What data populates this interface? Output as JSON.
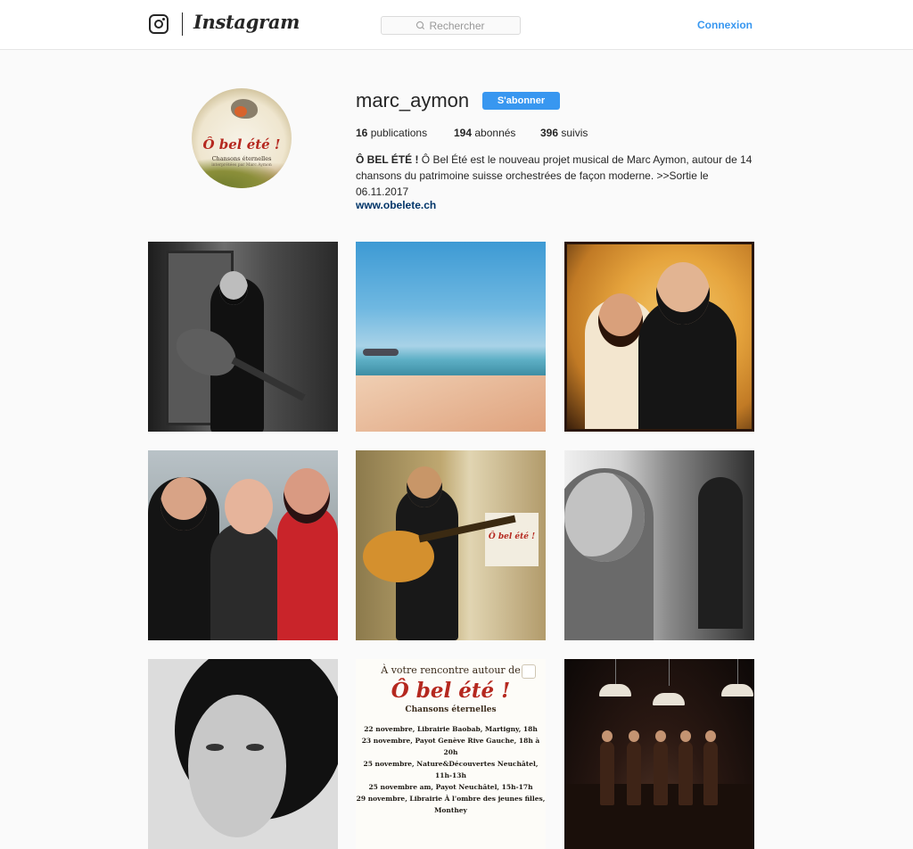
{
  "nav": {
    "wordmark": "Instagram",
    "search_placeholder": "Rechercher",
    "login_label": "Connexion",
    "icons": [
      "camera-icon",
      "search-icon"
    ]
  },
  "profile": {
    "username": "marc_aymon",
    "follow_label": "S'abonner",
    "stats": {
      "posts_count": "16",
      "posts_label": "publications",
      "followers_count": "194",
      "followers_label": "abonnés",
      "following_count": "396",
      "following_label": "suivis"
    },
    "bio_name": "Ô BEL ÉTÉ !",
    "bio_text": "Ô Bel Été est le nouveau projet musical de Marc Aymon, autour de 14 chansons du patrimoine suisse orchestrées de façon moderne. >>Sortie le 06.11.2017",
    "website": "www.obelete.ch",
    "avatar": {
      "title": "Ô bel été !",
      "subtitle": "Chansons éternelles",
      "caption": "interprétées par Marc Aymon"
    }
  },
  "posts": [
    {
      "id": "post-1"
    },
    {
      "id": "post-2"
    },
    {
      "id": "post-3"
    },
    {
      "id": "post-4"
    },
    {
      "id": "post-5",
      "poster_text": "Ô bel été !"
    },
    {
      "id": "post-6"
    },
    {
      "id": "post-7"
    },
    {
      "id": "post-8",
      "heading": "À votre rencontre autour de",
      "title": "Ô bel été !",
      "subtitle": "Chansons éternelles",
      "lines": [
        "22 novembre, Librairie Baobab, Martigny, 18h",
        "23 novembre, Payot Genève Rive Gauche, 18h à 20h",
        "25 novembre, Nature&Découvertes Neuchâtel, 11h-13h",
        "25 novembre am, Payot Neuchâtel, 15h-17h",
        "29 novembre, Librairie À l'ombre des jeunes filles, Monthey"
      ]
    },
    {
      "id": "post-9"
    }
  ],
  "colors": {
    "accent": "#3897f0",
    "link": "#003569",
    "text": "#262626",
    "background": "#fafafa"
  }
}
